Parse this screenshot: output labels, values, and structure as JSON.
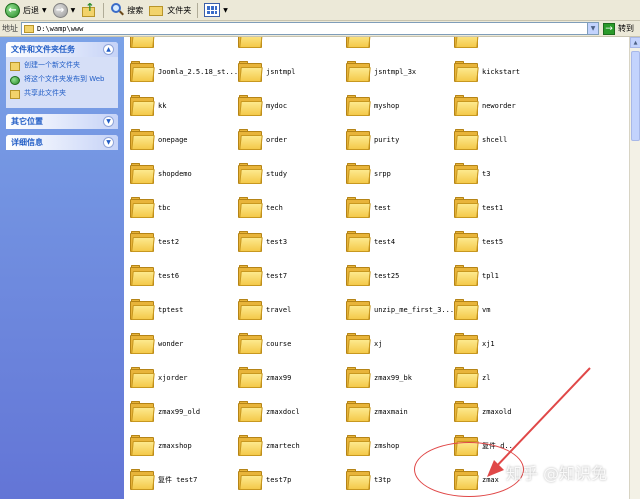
{
  "toolbar": {
    "back_label": "后退",
    "search_label": "搜索",
    "folders_label": "文件夹"
  },
  "address": {
    "label": "地址",
    "path": "D:\\wamp\\www",
    "go_label": "转到"
  },
  "leftpane": {
    "tasks_title": "文件和文件夹任务",
    "tasks": [
      {
        "label": "创建一个新文件夹",
        "icon": "folder-icon"
      },
      {
        "label": "将这个文件夹发布到 Web",
        "icon": "globe-icon"
      },
      {
        "label": "共享此文件夹",
        "icon": "folder-icon"
      }
    ],
    "other_places_title": "其它位置",
    "details_title": "详细信息"
  },
  "folders": [
    [
      "",
      "",
      "",
      ""
    ],
    [
      "Joomla_2.5.18_st...",
      "jsntmpl",
      "jsntmpl_3x",
      "kickstart"
    ],
    [
      "kk",
      "mydoc",
      "myshop",
      "neworder"
    ],
    [
      "onepage",
      "order",
      "purity",
      "shcell"
    ],
    [
      "shopdemo",
      "study",
      "srpp",
      "t3"
    ],
    [
      "tbc",
      "tech",
      "test",
      "test1"
    ],
    [
      "test2",
      "test3",
      "test4",
      "test5"
    ],
    [
      "test6",
      "test7",
      "test25",
      "tpl1"
    ],
    [
      "tptest",
      "travel",
      "unzip_me_first_3...",
      "vm"
    ],
    [
      "wonder",
      "course",
      "xj",
      "xj1"
    ],
    [
      "xjorder",
      "zmax99",
      "zmax99_bk",
      "zl"
    ],
    [
      "zmax99_old",
      "zmaxdocl",
      "zmaxmain",
      "zmaxold"
    ],
    [
      "zmaxshop",
      "zmartech",
      "zmshop",
      "复件 d..."
    ],
    [
      "复件 test7",
      "test7p",
      "t3tp",
      "zmax"
    ]
  ],
  "annotation": {
    "watermark": "知乎 @知识免",
    "accent_color": "#e04848"
  }
}
